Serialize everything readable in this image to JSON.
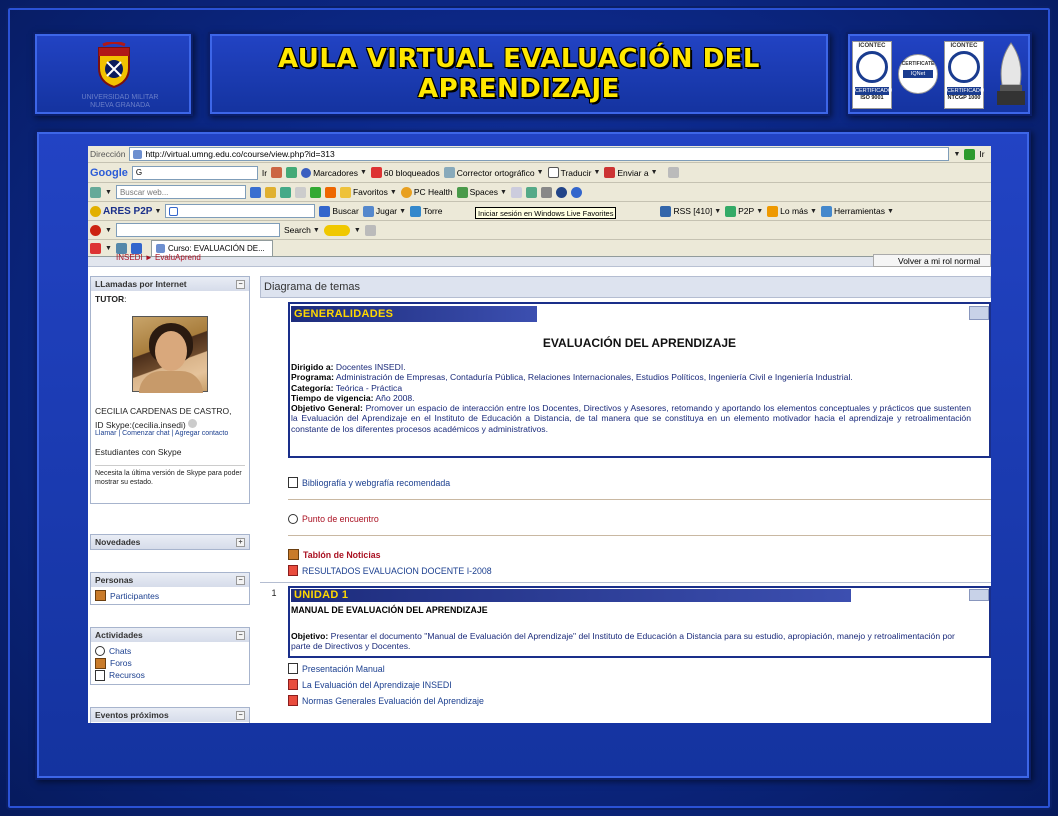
{
  "slide": {
    "title": "AULA VIRTUAL EVALUACIÓN DEL APRENDIZAJE",
    "title_line1": "AULA  VIRTUAL  EVALUACIÓN DEL",
    "title_line2": "APRENDIZAJE",
    "logo_caption_1": "UNIVERSIDAD MILITAR",
    "logo_caption_2": "NUEVA GRANADA",
    "certs": [
      {
        "top": "ICONTEC",
        "bottom": "CERTIFICADO",
        "code": "ISO 9001"
      },
      {
        "top": "CERTIFICATE",
        "bottom": "IQNet",
        "code": ""
      },
      {
        "top": "ICONTEC",
        "bottom": "CERTIFICADO",
        "code": "NTCGP 1000"
      }
    ],
    "colors": {
      "title": "#ffe800",
      "panel": "#2243c4",
      "background": "#0d2a8e"
    }
  },
  "browser": {
    "address_label": "Dirección",
    "url": "http://virtual.umng.edu.co/course/view.php?id=313",
    "go_label": "Ir",
    "google": {
      "logo": "Google",
      "search_value": "G",
      "go": "Ir",
      "bookmarks": "Marcadores",
      "blocked": "60 bloqueados",
      "spell": "Corrector ortográfico",
      "translate": "Traducir",
      "send": "Enviar a"
    },
    "live": {
      "search_placeholder": "Buscar web...",
      "favorites": "Favoritos",
      "pc_health": "PC Health",
      "spaces": "Spaces"
    },
    "ares": {
      "name": "ARES P2P",
      "search": "Buscar",
      "play": "Jugar",
      "torrent": "Torre",
      "tooltip": "Iniciar sesión en Windows Live Favorites",
      "rss": "RSS [410]",
      "p2p": "P2P",
      "more": "Lo más",
      "tools": "Herramientas"
    },
    "search_toolbar": {
      "search": "Search"
    },
    "tab_title": "Curso: EVALUACIÓN DE..."
  },
  "page": {
    "breadcrumb": "INSEDI ► EvaluAprend",
    "back_button": "Volver a mi rol normal",
    "sidebar": {
      "calls": {
        "title": "LLamadas por Internet",
        "tutor_label": "TUTOR",
        "tutor_suffix": ":",
        "tutor_name": "CECILIA CARDENAS DE CASTRO,",
        "skype_id": "ID Skype:(cecilia.insedi)",
        "links": [
          "Llamar",
          "Comenzar chat",
          "Agregar contacto"
        ],
        "students": "Estudiantes con Skype",
        "notice": "Necesita la última versión de Skype para poder mostrar su estado."
      },
      "news": {
        "title": "Novedades",
        "toggle": "+"
      },
      "people": {
        "title": "Personas",
        "toggle": "−",
        "items": [
          "Participantes"
        ]
      },
      "activities": {
        "title": "Actividades",
        "toggle": "−",
        "items": [
          "Chats",
          "Foros",
          "Recursos"
        ]
      },
      "events": {
        "title": "Eventos próximos",
        "toggle": "−"
      }
    },
    "main": {
      "header": "Diagrama de temas",
      "generalidades": {
        "label": "GENERALIDADES",
        "heading": "EVALUACIÓN DEL APRENDIZAJE",
        "dirigido_label": "Dirigido a:",
        "dirigido": " Docentes INSEDI.",
        "programa_label": "Programa:",
        "programa": " Administración de Empresas, Contaduría  Pública,  Relaciones Internacionales,  Estudios  Políticos, Ingeniería  Civil e Ingeniería  Industrial.",
        "categoria_label": "Categoría:",
        "categoria": " Teórica - Práctica",
        "vigencia_label": "Tiempo de vigencia:",
        "vigencia": " Año  2008.",
        "objetivo_label": "Objetivo  General:",
        "objetivo": " Promover  un  espacio  de  interacción  entre  los  Docentes,  Directivos  y  Asesores,  retomando  y  aportando  los  elementos conceptuales  y  prácticos  que  sustenten  la Evaluación  del  Aprendizaje en el  Instituto  de  Educación  a  Distancia,  de tal manera que se constituya en un elemento  motivador   hacia  el  aprendizaje y  retroalimentación  constante de los  diferentes procesos académicos  y  administrativos."
      },
      "resources_0": [
        {
          "label": "Bibliografía y webgrafía recomendada",
          "icon": "document-icon"
        },
        {
          "label": "Punto de encuentro",
          "icon": "forum-icon"
        },
        {
          "label": "Tablón de Noticias",
          "icon": "news-icon"
        },
        {
          "label": "RESULTADOS EVALUACION DOCENTE I-2008",
          "icon": "pdf-icon"
        }
      ],
      "unit1": {
        "number": "1",
        "label": "UNIDAD 1",
        "heading": "MANUAL DE EVALUACIÓN DEL APRENDIZAJE",
        "objetivo_label": "Objetivo:",
        "objetivo": " Presentar el documento \"Manual de Evaluación del Aprendizaje\" del Instituto de Educación a Distancia para su estudio, apropiación, manejo y retroalimentación por parte de Directivos y Docentes.",
        "resources": [
          {
            "label": "Presentación Manual",
            "icon": "document-icon"
          },
          {
            "label": "La Evaluación del Aprendizaje INSEDI",
            "icon": "pdf-icon"
          },
          {
            "label": "Normas Generales Evaluación del Aprendizaje",
            "icon": "pdf-icon"
          }
        ]
      }
    }
  }
}
